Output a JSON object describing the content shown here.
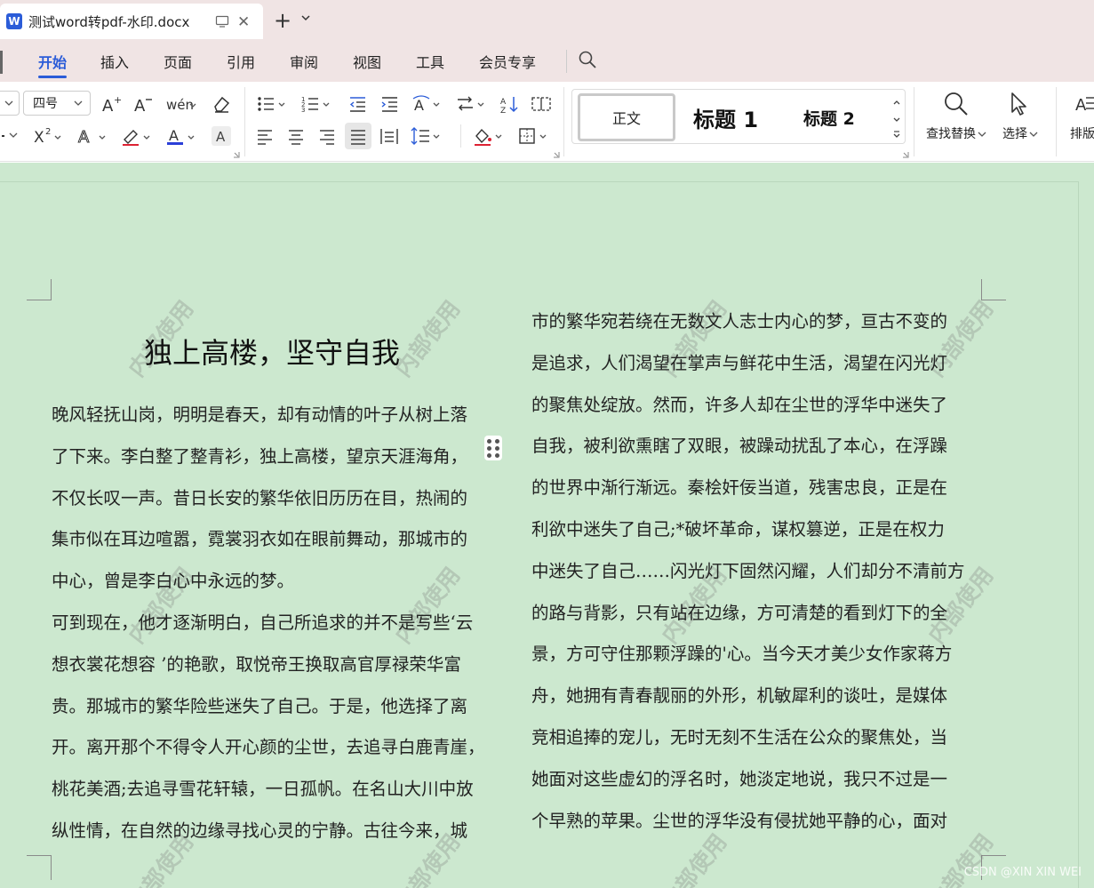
{
  "titlebar": {
    "app_icon_letter": "W",
    "doc_tab_title": "测试word转pdf-水印.docx",
    "close_glyph": "✕",
    "new_tab_glyph": "+"
  },
  "menu": {
    "items": [
      "开始",
      "插入",
      "页面",
      "引用",
      "审阅",
      "视图",
      "工具",
      "会员专享"
    ],
    "active_index": 0
  },
  "ribbon": {
    "font_size_value": "四号",
    "styles": {
      "normal": "正文",
      "heading1": "标题  1",
      "heading2": "标题  2"
    },
    "find_replace_label": "查找替换",
    "select_label": "选择",
    "layout_label_partial": "排版"
  },
  "document": {
    "title": "独上高楼，坚守自我",
    "left_column_lines": [
      "晚风轻抚山岗，明明是春天，却有动情的叶子从树上落",
      "了下来。李白整了整青衫，独上高楼，望京天涯海角，",
      "不仅长叹一声。昔日长安的繁华依旧历历在目，热闹的",
      "集市似在耳边喧嚣，霓裳羽衣如在眼前舞动，那城市的",
      "中心，曾是李白心中永远的梦。",
      "可到现在，他才逐渐明白，自己所追求的并不是写些‘云",
      "想衣裳花想容 ’的艳歌，取悦帝王换取高官厚禄荣华富",
      "贵。那城市的繁华险些迷失了自己。于是，他选择了离",
      "开。离开那个不得令人开心颜的尘世，去追寻白鹿青崖，",
      "桃花美酒;去追寻雪花轩辕，一日孤帆。在名山大川中放",
      "纵性情，在自然的边缘寻找心灵的宁静。古往今来，城"
    ],
    "right_column_lines": [
      "市的繁华宛若绕在无数文人志士内心的梦，亘古不变的",
      "是追求，人们渴望在掌声与鲜花中生活，渴望在闪光灯",
      "的聚焦处绽放。然而，许多人却在尘世的浮华中迷失了",
      "自我，被利欲熏瞎了双眼，被躁动扰乱了本心，在浮躁",
      "的世界中渐行渐远。秦桧奸佞当道，残害忠良，正是在",
      "利欲中迷失了自己;*破坏革命，谋权篡逆，正是在权力",
      "中迷失了自己……闪光灯下固然闪耀，人们却分不清前方",
      "的路与背影，只有站在边缘，方可清楚的看到灯下的全",
      "景，方可守住那颗浮躁的'心。当今天才美少女作家蒋方",
      "舟，她拥有青春靓丽的外形，机敏犀利的谈吐，是媒体",
      "竞相追捧的宠儿，无时无刻不生活在公众的聚焦处，当",
      "她面对这些虚幻的浮名时，她淡定地说，我只不过是一",
      "个早熟的苹果。尘世的浮华没有侵扰她平静的心，面对"
    ],
    "watermark_text": "内部使用"
  },
  "credit": "CSDN @XIN XIN WEI",
  "colors": {
    "accent": "#2b5cd8",
    "titlebar_bg": "#f0e4e4",
    "page_bg": "#cce8cf"
  }
}
